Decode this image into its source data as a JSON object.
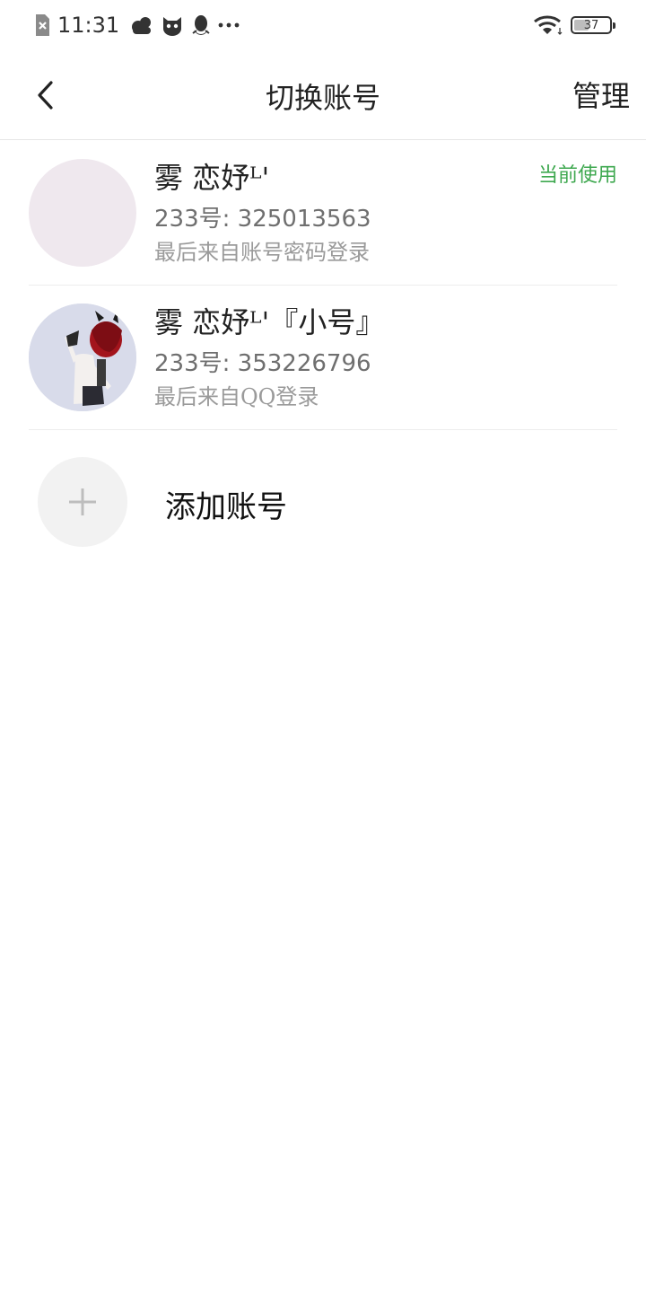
{
  "status_bar": {
    "time": "11:31",
    "battery_level": "37",
    "battery_fraction": 0.37,
    "icons_left": [
      "no-sim-icon",
      "cloud-weather-icon",
      "cat-app-icon",
      "qq-penguin-icon",
      "more-dots-icon"
    ],
    "icons_right": [
      "wifi-icon",
      "battery-icon"
    ]
  },
  "header": {
    "title": "切换账号",
    "back_icon": "chevron-left-icon",
    "manage_label": "管理"
  },
  "accounts": [
    {
      "name": "雾  恋妤ᴸ'",
      "id_text": "233号: 325013563",
      "login_text": "最后来自账号密码登录",
      "status": "当前使用",
      "avatar": "blank-avatar"
    },
    {
      "name": "雾  恋妤ᴸ'『小号』",
      "id_text": "233号: 353226796",
      "login_text": "最后来自QQ登录",
      "status": "",
      "avatar": "character-avatar"
    }
  ],
  "add_account": {
    "label": "添加账号",
    "icon": "plus-icon"
  },
  "colors": {
    "accent_green": "#3ea84f",
    "secondary_text": "#6f6f6f",
    "tertiary_text": "#9a9a9a",
    "divider": "#ececec"
  }
}
